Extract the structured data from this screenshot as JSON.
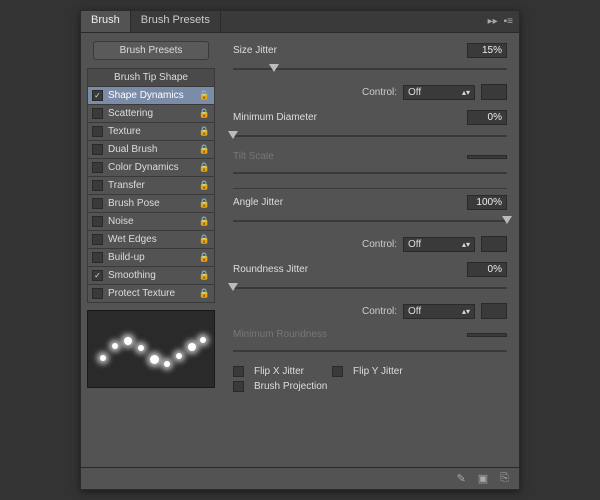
{
  "tabs": {
    "brush": "Brush",
    "presets": "Brush Presets"
  },
  "sidebar": {
    "presets_btn": "Brush Presets",
    "tip_shape": "Brush Tip Shape",
    "items": [
      {
        "label": "Shape Dynamics",
        "checked": true,
        "selected": true
      },
      {
        "label": "Scattering",
        "checked": false
      },
      {
        "label": "Texture",
        "checked": false
      },
      {
        "label": "Dual Brush",
        "checked": false
      },
      {
        "label": "Color Dynamics",
        "checked": false
      },
      {
        "label": "Transfer",
        "checked": false
      },
      {
        "label": "Brush Pose",
        "checked": false
      },
      {
        "label": "Noise",
        "checked": false
      },
      {
        "label": "Wet Edges",
        "checked": false
      },
      {
        "label": "Build-up",
        "checked": false
      },
      {
        "label": "Smoothing",
        "checked": true
      },
      {
        "label": "Protect Texture",
        "checked": false
      }
    ]
  },
  "content": {
    "size_jitter": {
      "label": "Size Jitter",
      "value": "15%",
      "pos": 15
    },
    "control_label": "Control:",
    "control_off": "Off",
    "min_diameter": {
      "label": "Minimum Diameter",
      "value": "0%",
      "pos": 0
    },
    "tilt_scale": "Tilt Scale",
    "angle_jitter": {
      "label": "Angle Jitter",
      "value": "100%",
      "pos": 100
    },
    "roundness_jitter": {
      "label": "Roundness Jitter",
      "value": "0%",
      "pos": 0
    },
    "min_roundness": "Minimum Roundness",
    "flip_x": "Flip X Jitter",
    "flip_y": "Flip Y Jitter",
    "brush_projection": "Brush Projection"
  }
}
